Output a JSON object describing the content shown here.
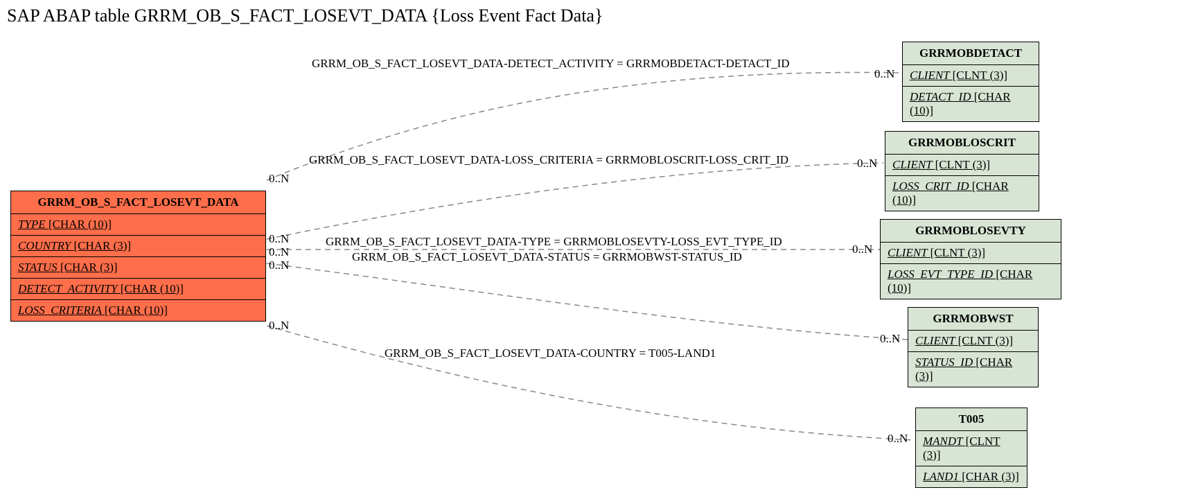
{
  "title": "SAP ABAP table GRRM_OB_S_FACT_LOSEVT_DATA {Loss Event Fact Data}",
  "main_entity": {
    "name": "GRRM_OB_S_FACT_LOSEVT_DATA",
    "rows": [
      {
        "field": "TYPE",
        "dtype": "[CHAR (10)]"
      },
      {
        "field": "COUNTRY",
        "dtype": "[CHAR (3)]"
      },
      {
        "field": "STATUS",
        "dtype": "[CHAR (3)]"
      },
      {
        "field": "DETECT_ACTIVITY",
        "dtype": "[CHAR (10)]"
      },
      {
        "field": "LOSS_CRITERIA",
        "dtype": "[CHAR (10)]"
      }
    ]
  },
  "ref_entities": [
    {
      "name": "GRRMOBDETACT",
      "rows": [
        {
          "field": "CLIENT",
          "dtype": "[CLNT (3)]"
        },
        {
          "field": "DETACT_ID",
          "dtype": "[CHAR (10)]"
        }
      ]
    },
    {
      "name": "GRRMOBLOSCRIT",
      "rows": [
        {
          "field": "CLIENT",
          "dtype": "[CLNT (3)]"
        },
        {
          "field": "LOSS_CRIT_ID",
          "dtype": "[CHAR (10)]"
        }
      ]
    },
    {
      "name": "GRRMOBLOSEVTY",
      "rows": [
        {
          "field": "CLIENT",
          "dtype": "[CLNT (3)]"
        },
        {
          "field": "LOSS_EVT_TYPE_ID",
          "dtype": "[CHAR (10)]"
        }
      ]
    },
    {
      "name": "GRRMOBWST",
      "rows": [
        {
          "field": "CLIENT",
          "dtype": "[CLNT (3)]"
        },
        {
          "field": "STATUS_ID",
          "dtype": "[CHAR (3)]"
        }
      ]
    },
    {
      "name": "T005",
      "rows": [
        {
          "field": "MANDT",
          "dtype": "[CLNT (3)]"
        },
        {
          "field": "LAND1",
          "dtype": "[CHAR (3)]"
        }
      ]
    }
  ],
  "relations": [
    "GRRM_OB_S_FACT_LOSEVT_DATA-DETECT_ACTIVITY = GRRMOBDETACT-DETACT_ID",
    "GRRM_OB_S_FACT_LOSEVT_DATA-LOSS_CRITERIA = GRRMOBLOSCRIT-LOSS_CRIT_ID",
    "GRRM_OB_S_FACT_LOSEVT_DATA-TYPE = GRRMOBLOSEVTY-LOSS_EVT_TYPE_ID",
    "GRRM_OB_S_FACT_LOSEVT_DATA-STATUS = GRRMOBWST-STATUS_ID",
    "GRRM_OB_S_FACT_LOSEVT_DATA-COUNTRY = T005-LAND1"
  ],
  "card_left": "0..N",
  "card_right": "0..N"
}
